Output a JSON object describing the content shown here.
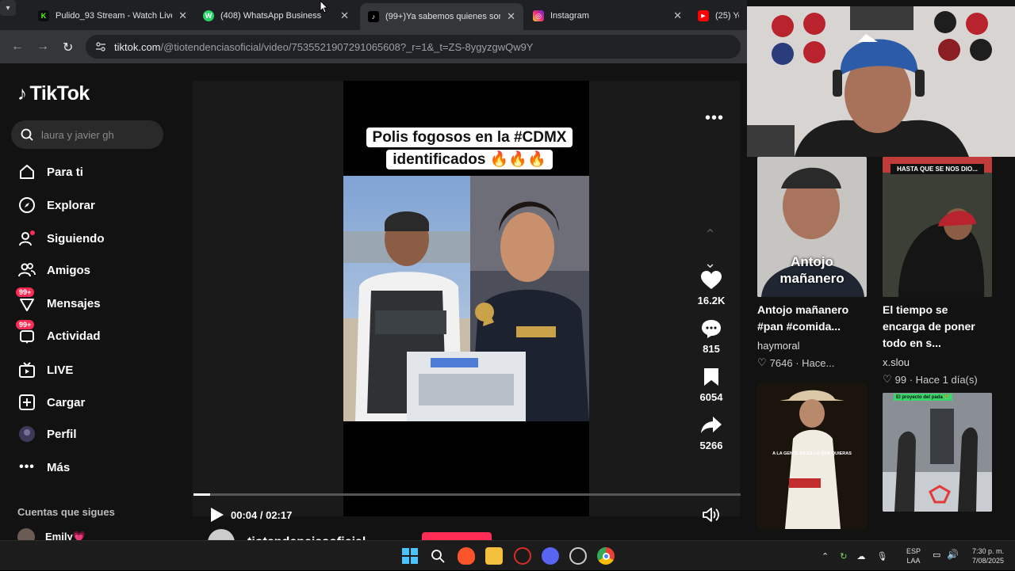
{
  "browser": {
    "tabs": [
      {
        "label": "Pulido_93 Stream - Watch Live on Kick",
        "favicon": "K",
        "favicon_color": "#53fc18"
      },
      {
        "label": "(408) WhatsApp Business",
        "favicon": "W",
        "favicon_color": "#25d366"
      },
      {
        "label": "(99+)Ya sabemos quienes son los agentes",
        "favicon": "♪",
        "favicon_color": "#000000"
      },
      {
        "label": "Instagram",
        "favicon": "◎",
        "favicon_color": "#e1306c"
      },
      {
        "label": "(25) YouTube",
        "favicon": "▶",
        "favicon_color": "#ff0000"
      }
    ],
    "active_tab": 2,
    "url_host": "tiktok.com",
    "url_path": "/@tiotendenciasoficial/video/7535521907291065608?_r=1&_t=ZS-8ygyzgwQw9Y"
  },
  "tiktok": {
    "logo": "TikTok",
    "search_placeholder": "laura y javier gh",
    "nav": [
      {
        "label": "Para ti",
        "icon": "home-icon"
      },
      {
        "label": "Explorar",
        "icon": "compass-icon"
      },
      {
        "label": "Siguiendo",
        "icon": "following-icon"
      },
      {
        "label": "Amigos",
        "icon": "friends-icon"
      },
      {
        "label": "Mensajes",
        "icon": "messages-icon",
        "badge": "99+"
      },
      {
        "label": "Actividad",
        "icon": "activity-icon",
        "badge": "99+"
      },
      {
        "label": "LIVE",
        "icon": "live-icon"
      },
      {
        "label": "Cargar",
        "icon": "upload-icon"
      },
      {
        "label": "Perfil",
        "icon": "profile-icon"
      },
      {
        "label": "Más",
        "icon": "more-icon"
      }
    ],
    "following_title": "Cuentas que sigues",
    "following_users": [
      "Emily💗"
    ]
  },
  "video": {
    "caption_line1": "Polis fogosos en la #CDMX",
    "caption_line2": "identificados 🔥🔥🔥",
    "likes": "16.2K",
    "comments": "815",
    "saves": "6054",
    "shares": "5266",
    "time": "00:04 / 02:17",
    "progress": 0.03,
    "author": "tiotendenciasoficial"
  },
  "recommended": [
    {
      "title": "Antojo mañanero #pan #comida...",
      "author": "haymoral",
      "meta": "7646 · Hace...",
      "overlay": "Antojo mañanero",
      "bg": "#4a5560"
    },
    {
      "title": "El tiempo se encarga de poner todo en s...",
      "author": "x.slou",
      "meta": "99 · Hace 1 día(s)",
      "overlay": "HASTA QUE SE NOS DIO...",
      "bg": "#2d3a2a"
    },
    {
      "title": "",
      "author": "",
      "meta": "",
      "overlay": "A LA GENTE DILES LO QUE QUIERAS",
      "bg": "#2a2015"
    },
    {
      "title": "",
      "author": "",
      "meta": "",
      "overlay": "El proyecto del pada 🏋",
      "bg": "#6a6e74"
    }
  ],
  "taskbar": {
    "lang_line1": "ESP",
    "lang_line2": "LAA",
    "time": "7:30 p. m.",
    "date": "7/08/2025"
  }
}
